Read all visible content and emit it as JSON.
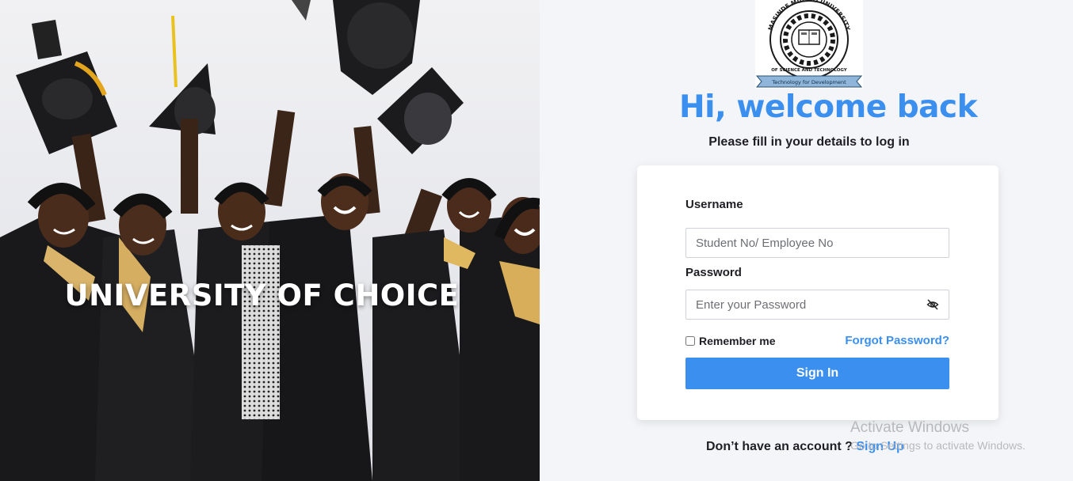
{
  "hero": {
    "title": "UNIVERSITY OF CHOICE"
  },
  "logo": {
    "arc_text": "MASINDE MULIRO UNIVERSITY",
    "lower_text": "OF SCIENCE AND TECHNOLOGY",
    "motto": "Technology for Development",
    "icon": "university-crest-icon"
  },
  "welcome": {
    "title": "Hi, welcome back",
    "subtitle": "Please fill in your details to log in"
  },
  "form": {
    "username_label": "Username",
    "username_placeholder": "Student No/ Employee No",
    "username_value": "",
    "password_label": "Password",
    "password_placeholder": "Enter your Password",
    "password_value": "",
    "password_toggle_icon": "eye-slash-icon",
    "remember_label": "Remember me",
    "remember_checked": false,
    "forgot_label": "Forgot Password?",
    "signin_label": "Sign In"
  },
  "footer": {
    "prompt": "Don’t have an account ? ",
    "signup_label": "Sign Up"
  },
  "watermark": {
    "line1": "Activate Windows",
    "line2": "Go to Settings to activate Windows."
  },
  "colors": {
    "accent": "#3b8fef",
    "background": "#f4f5f9",
    "card": "#ffffff",
    "text": "#1e1e24"
  }
}
